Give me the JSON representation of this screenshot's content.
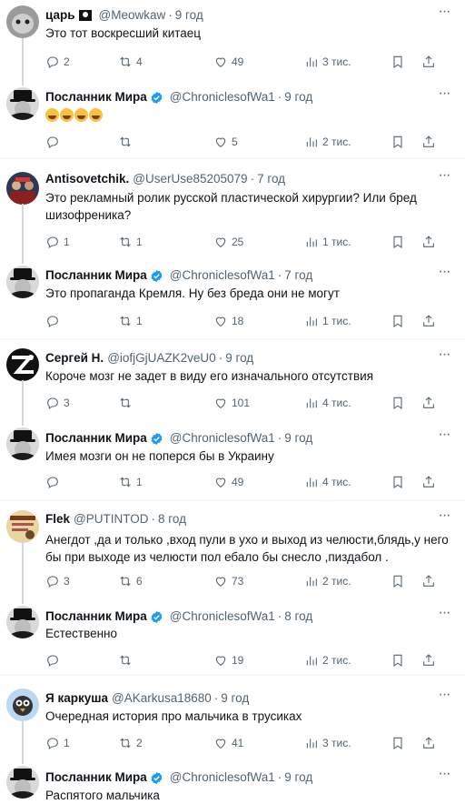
{
  "tweets": [
    {
      "name": "царь",
      "name_suffix_icon": "pirate-flag-icon",
      "verified": false,
      "handle": "@Meowkaw",
      "time": "9 год",
      "text": "Это тот воскресший китаец",
      "reply": "2",
      "retweet": "4",
      "like": "49",
      "views": "3 тис.",
      "avatar": "cat"
    },
    {
      "name": "Посланник Мира",
      "verified": true,
      "handle": "@ChroniclesofWa1",
      "time": "9 год",
      "text": "",
      "emoji_count": 4,
      "reply": "",
      "retweet": "",
      "like": "5",
      "views": "2 тис.",
      "avatar": "hat"
    },
    {
      "name": "Antisovetchik.",
      "verified": false,
      "handle": "@UserUse85205079",
      "time": "7 год",
      "text": "Это рекламный ролик русской пластической хирургии? Или бред шизофреника?",
      "reply": "1",
      "retweet": "1",
      "like": "25",
      "views": "1 тис.",
      "avatar": "people"
    },
    {
      "name": "Посланник Мира",
      "verified": true,
      "handle": "@ChroniclesofWa1",
      "time": "7 год",
      "text": "Это пропаганда Кремля. Ну без бреда  они не могут",
      "reply": "",
      "retweet": "1",
      "like": "18",
      "views": "1 тис.",
      "avatar": "hat"
    },
    {
      "name": "Сергей Н.",
      "verified": false,
      "handle": "@iofjGjUAZK2veU0",
      "time": "9 год",
      "text": "Короче мозг не задет в виду его изначального отсутствия",
      "reply": "3",
      "retweet": "",
      "like": "101",
      "views": "4 тис.",
      "avatar": "bw"
    },
    {
      "name": "Посланник Мира",
      "verified": true,
      "handle": "@ChroniclesofWa1",
      "time": "9 год",
      "text": "Имея мозги он не поперся бы в Украину",
      "reply": "",
      "retweet": "1",
      "like": "49",
      "views": "4 тис.",
      "avatar": "hat"
    },
    {
      "name": "Flek",
      "verified": false,
      "handle": "@PUTINTOD",
      "time": "8 год",
      "text": "Анегдот ,да и только ,вход пули в ухо и выход из челюсти,блядь,у него бы при выходе из челюсти пол ебало бы снесло ,пиздабол .",
      "reply": "3",
      "retweet": "6",
      "like": "73",
      "views": "2 тис.",
      "avatar": "poster"
    },
    {
      "name": "Посланник Мира",
      "verified": true,
      "handle": "@ChroniclesofWa1",
      "time": "8 год",
      "text": "Естественно",
      "reply": "",
      "retweet": "",
      "like": "19",
      "views": "2 тис.",
      "avatar": "hat"
    },
    {
      "name": "Я каркуша",
      "verified": false,
      "handle": "@AKarkusa18680",
      "time": "9 год",
      "text": "Очередная история про мальчика в трусиках",
      "reply": "1",
      "retweet": "2",
      "like": "41",
      "views": "3 тис.",
      "avatar": "bird"
    },
    {
      "name": "Посланник Мира",
      "verified": true,
      "handle": "@ChroniclesofWa1",
      "time": "9 год",
      "text": "Распятого мальчика",
      "reply": "",
      "retweet": "",
      "like": "",
      "views": "",
      "avatar": "hat"
    }
  ],
  "ui": {
    "more_label": "···"
  },
  "colors": {
    "verified": "#1d9bf0",
    "muted": "#536471",
    "text": "#0f1419",
    "divider": "#eff3f4",
    "thread_line": "#cfd9de"
  }
}
